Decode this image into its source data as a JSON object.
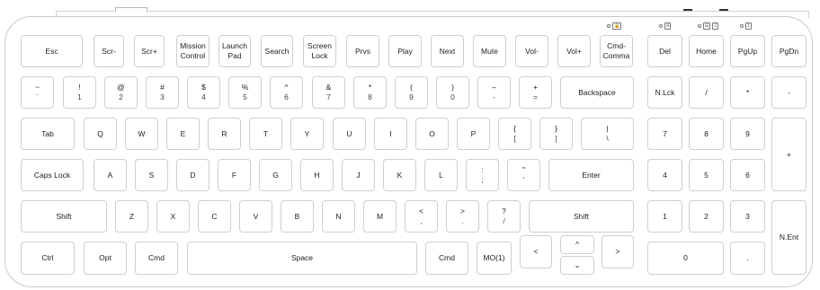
{
  "indicators": {
    "lock": "🔒",
    "del_mark": "A",
    "home_mark": "⊞",
    "home_mark2": "1",
    "pgup_mark": "1"
  },
  "keys": {
    "esc": "Esc",
    "scr_minus": "Scr-",
    "scr_plus": "Scr+",
    "mission_1": "Mission",
    "mission_2": "Control",
    "launch_1": "Launch",
    "launch_2": "Pad",
    "search": "Search",
    "screen_1": "Screen",
    "screen_2": "Lock",
    "prvs": "Prvs",
    "play": "Play",
    "next": "Next",
    "mute": "Mute",
    "vol_minus": "Vol-",
    "vol_plus": "Vol+",
    "cmd_comma_1": "Cmd-",
    "cmd_comma_2": "Comma",
    "del": "Del",
    "home": "Home",
    "pgup": "PgUp",
    "pgdn": "PgDn",
    "tilde_top": "~",
    "tilde_bot": "`",
    "k1_top": "!",
    "k1_bot": "1",
    "k2_top": "@",
    "k2_bot": "2",
    "k3_top": "#",
    "k3_bot": "3",
    "k4_top": "$",
    "k4_bot": "4",
    "k5_top": "%",
    "k5_bot": "5",
    "k6_top": "^",
    "k6_bot": "6",
    "k7_top": "&",
    "k7_bot": "7",
    "k8_top": "*",
    "k8_bot": "8",
    "k9_top": "(",
    "k9_bot": "9",
    "k0_top": ")",
    "k0_bot": "0",
    "minus_top": "–",
    "minus_bot": "-",
    "equal_top": "+",
    "equal_bot": "=",
    "backspace": "Backspace",
    "nlck": "N.Lck",
    "num_slash": "/",
    "num_star": "*",
    "num_minus": "-",
    "tab": "Tab",
    "q": "Q",
    "w": "W",
    "e": "E",
    "r": "R",
    "t": "T",
    "y": "Y",
    "u": "U",
    "i": "I",
    "o": "O",
    "p": "P",
    "lbracket_top": "{",
    "lbracket_bot": "[",
    "rbracket_top": "}",
    "rbracket_bot": "]",
    "backslash_top": "|",
    "backslash_bot": "\\",
    "num7": "7",
    "num8": "8",
    "num9": "9",
    "num_plus": "+",
    "caps": "Caps Lock",
    "a": "A",
    "s": "S",
    "d": "D",
    "f": "F",
    "g": "G",
    "h": "H",
    "j": "J",
    "k": "K",
    "l": "L",
    "semicolon_top": ":",
    "semicolon_bot": ";",
    "quote_top": "\"",
    "quote_bot": "'",
    "enter": "Enter",
    "num4": "4",
    "num5": "5",
    "num6": "6",
    "lshift": "Shift",
    "z": "Z",
    "x": "X",
    "c": "C",
    "v": "V",
    "b": "B",
    "n": "N",
    "m": "M",
    "comma_top": "<",
    "comma_bot": ",",
    "period_top": ">",
    "period_bot": ".",
    "slash_top": "?",
    "slash_bot": "/",
    "rshift": "Shift",
    "num1": "1",
    "num2": "2",
    "num3": "3",
    "nent": "N.Ent",
    "ctrl": "Ctrl",
    "opt": "Opt",
    "lcmd": "Cmd",
    "space": "Space",
    "rcmd": "Cmd",
    "mo1": "MO(1)",
    "left": "<",
    "up": "^",
    "down": "⌄",
    "right": ">",
    "num0": "0",
    "num_dot": "."
  }
}
